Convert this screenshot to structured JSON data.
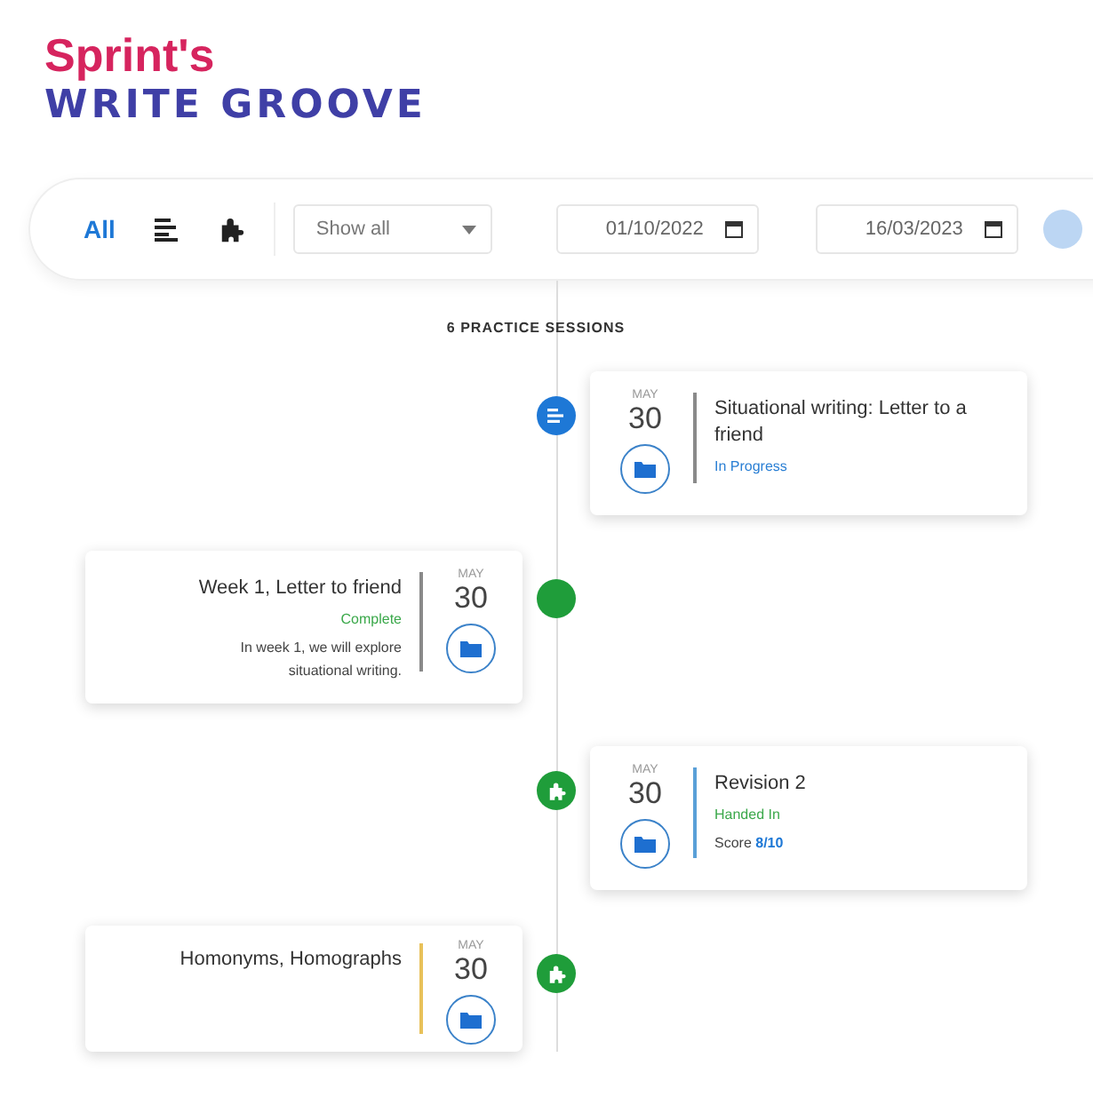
{
  "logo": {
    "line_1": "Sprint's",
    "line_2": "WRITE GROOVE"
  },
  "toolbar": {
    "tabs": [
      {
        "kind": "text",
        "label": "All",
        "selected": true
      },
      {
        "kind": "list",
        "selected": false
      },
      {
        "kind": "puzzle",
        "selected": false
      }
    ],
    "filter": {
      "value": "Show all"
    },
    "date_from": "01/10/2022",
    "date_to": "16/03/2023"
  },
  "sessions_label": "6 PRACTICE SESSIONS",
  "sessions": [
    {
      "kind": "document",
      "color": "#1e78d6",
      "month": "MAY",
      "day": "30",
      "title": "Situational writing: Letter to a friend",
      "divider": {
        "color": "#8a8a8a"
      },
      "status": {
        "kind": "progress",
        "label": "In Progress"
      }
    },
    {
      "kind": "plain",
      "color": "#1f9d3a",
      "month": "MAY",
      "day": "30",
      "title": "Week 1, Letter to friend",
      "divider": {
        "color": "#8a8a8a"
      },
      "status": {
        "kind": "done",
        "label": "Complete"
      },
      "description": "In week 1, we will explore situational writing."
    },
    {
      "kind": "puzzle",
      "color": "#1f9d3a",
      "month": "MAY",
      "day": "30",
      "title": "Revision 2",
      "divider": {
        "color": "#5aa0d8"
      },
      "status": {
        "kind": "done",
        "label": "Handed In"
      },
      "score_label": "Score",
      "score": "8/10"
    },
    {
      "kind": "puzzle",
      "color": "#1f9d3a",
      "month": "MAY",
      "day": "30",
      "title": "Homonyms, Homographs",
      "divider": {
        "color": "#e8c15a"
      }
    }
  ]
}
